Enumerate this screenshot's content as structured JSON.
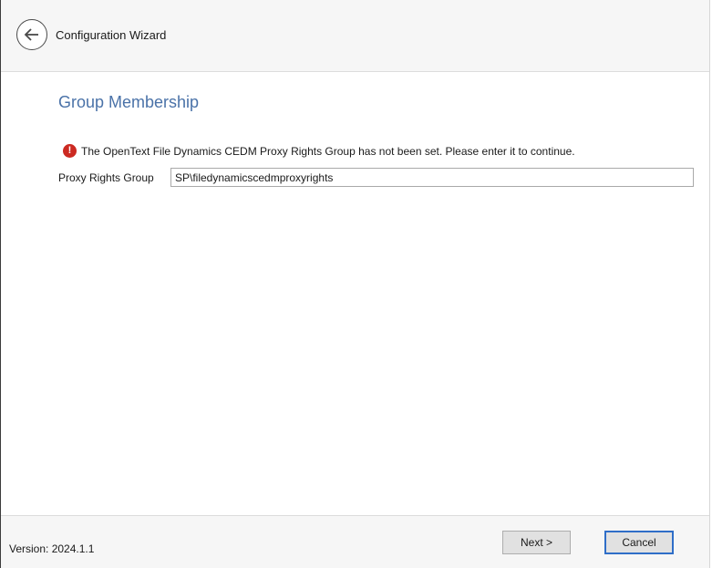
{
  "window": {
    "title": "Configuration Wizard"
  },
  "page": {
    "title": "Group Membership",
    "error_message": "The OpenText File Dynamics CEDM Proxy Rights Group has not been set. Please enter it to continue.",
    "error_icon": "error-icon",
    "error_color": "#cc2a22",
    "accent_color": "#4a72a8"
  },
  "form": {
    "proxy_rights_group": {
      "label": "Proxy Rights Group",
      "value": "SP\\filedynamicscedmproxyrights"
    }
  },
  "footer": {
    "version": "Version: 2024.1.1",
    "next_label": "Next >",
    "cancel_label": "Cancel"
  },
  "icons": {
    "back": "arrow-left-icon"
  }
}
